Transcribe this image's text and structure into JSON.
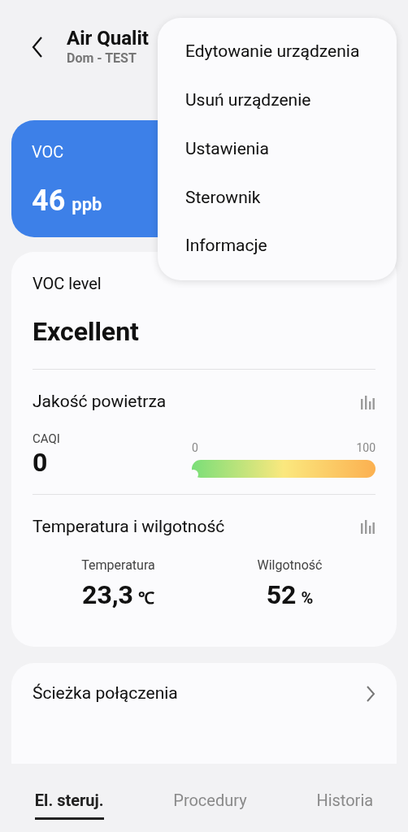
{
  "header": {
    "title": "Air Qualit",
    "subtitle": "Dom - TEST"
  },
  "voc_tile": {
    "label": "VOC",
    "value": "46",
    "unit": "ppb"
  },
  "menu": {
    "items": [
      {
        "label": "Edytowanie urządzenia"
      },
      {
        "label": "Usuń urządzenie"
      },
      {
        "label": "Ustawienia"
      },
      {
        "label": "Sterownik"
      },
      {
        "label": "Informacje"
      }
    ]
  },
  "voc_level": {
    "label": "VOC level",
    "value": "Excellent"
  },
  "air_quality": {
    "title": "Jakość powietrza",
    "index_label": "CAQI",
    "index_value": "0",
    "scale_min": "0",
    "scale_max": "100",
    "level": 0
  },
  "climate": {
    "title": "Temperatura i wilgotność",
    "readings": [
      {
        "label": "Temperatura",
        "value": "23,3",
        "unit": "℃"
      },
      {
        "label": "Wilgotność",
        "value": "52",
        "unit": "%"
      }
    ]
  },
  "connection_path": {
    "title": "Ścieżka połączenia"
  },
  "tabs": [
    {
      "label": "El. steruj.",
      "selected": true
    },
    {
      "label": "Procedury",
      "selected": false
    },
    {
      "label": "Historia",
      "selected": false
    }
  ]
}
